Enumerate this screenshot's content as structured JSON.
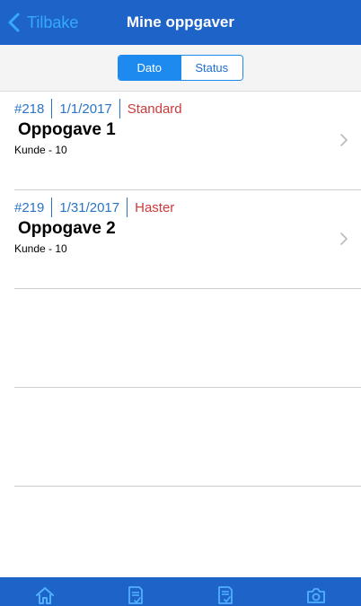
{
  "header": {
    "back_label": "Tilbake",
    "title": "Mine oppgaver"
  },
  "segment": {
    "options": [
      "Dato",
      "Status"
    ],
    "selected": "Dato"
  },
  "tasks": [
    {
      "id": "#218",
      "date": "1/1/2017",
      "priority": "Standard",
      "name": "Oppogave 1",
      "customer": "Kunde - 10"
    },
    {
      "id": "#219",
      "date": "1/31/2017",
      "priority": "Haster",
      "name": "Oppogave 2",
      "customer": "Kunde - 10"
    }
  ],
  "tabbar": {
    "icons": [
      "home-icon",
      "task-list-check-icon",
      "document-check-icon",
      "camera-icon"
    ]
  },
  "colors": {
    "header_bg": "#1d63c8",
    "accent": "#1d8af0",
    "meta_text": "#2a74c6",
    "priority_text": "#cc3a3a"
  }
}
